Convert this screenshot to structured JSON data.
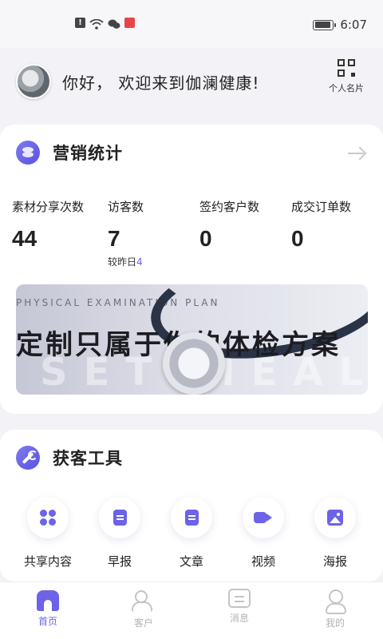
{
  "status_bar": {
    "time": "6:07",
    "icons": [
      "notification-icon",
      "wifi-icon",
      "wechat-icon",
      "app-icon"
    ],
    "battery_level": 0.9
  },
  "header": {
    "greeting": "你好， 欢迎来到伽澜健康!",
    "card_label": "个人名片"
  },
  "stats": {
    "title": "营销统计",
    "items": [
      {
        "label": "素材分享次数",
        "value": "44"
      },
      {
        "label": "访客数",
        "value": "7",
        "compare_label": "较昨日",
        "compare_value": "4"
      },
      {
        "label": "签约客户数",
        "value": "0"
      },
      {
        "label": "成交订单数",
        "value": "0"
      }
    ]
  },
  "banner": {
    "title": "定制只属于你的体检方案",
    "subtitle": "PHYSICAL EXAMINATION PLAN",
    "bg_text": "SET MEAL"
  },
  "tools": {
    "title": "获客工具",
    "items": [
      {
        "label": "共享内容",
        "icon": "share-icon"
      },
      {
        "label": "早报",
        "icon": "doc-icon"
      },
      {
        "label": "文章",
        "icon": "doc-icon"
      },
      {
        "label": "视频",
        "icon": "video-icon"
      },
      {
        "label": "海报",
        "icon": "image-icon"
      }
    ]
  },
  "nav": {
    "items": [
      {
        "label": "首页",
        "icon": "home-icon",
        "active": true
      },
      {
        "label": "客户",
        "icon": "client-icon"
      },
      {
        "label": "消息",
        "icon": "message-icon"
      },
      {
        "label": "我的",
        "icon": "profile-icon"
      }
    ]
  },
  "colors": {
    "accent": "#6c63e8",
    "inactive": "#b3b3b8"
  }
}
